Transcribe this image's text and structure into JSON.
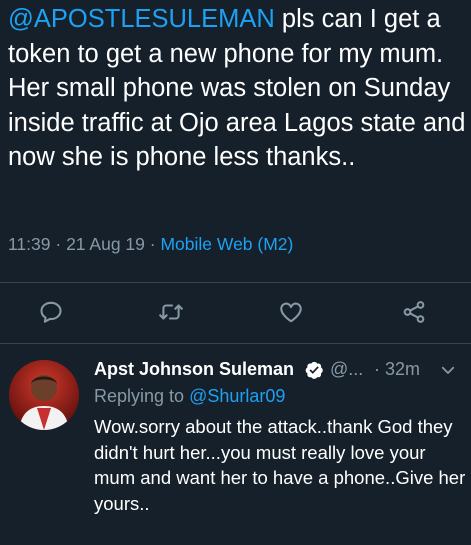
{
  "tweet": {
    "mention": "@APOSTLESULEMAN",
    "body": " pls can I get a token to get a new phone for my mum. Her small phone was stolen on Sunday inside traffic at Ojo area Lagos state and now she is phone less thanks..",
    "time": "11:39",
    "dot1": " · ",
    "date": "21 Aug 19",
    "dot2": " · ",
    "source": "Mobile Web (M2)"
  },
  "actions": {
    "icons": [
      "reply-icon",
      "retweet-icon",
      "like-icon",
      "share-icon"
    ]
  },
  "reply": {
    "name": "Apst Johnson Suleman",
    "handle": "@...",
    "time": "· 32m",
    "replying_prefix": "Replying to ",
    "replying_to": "@Shurlar09",
    "text": "Wow.sorry about the attack..thank God they didn't hurt her...you must really love your mum and  want her to have a phone..Give her yours.."
  },
  "colors": {
    "background": "#15202b",
    "accent": "#1da1f2",
    "secondary_text": "#8899a6",
    "divider": "#38444d",
    "verified": "#ffffff"
  }
}
